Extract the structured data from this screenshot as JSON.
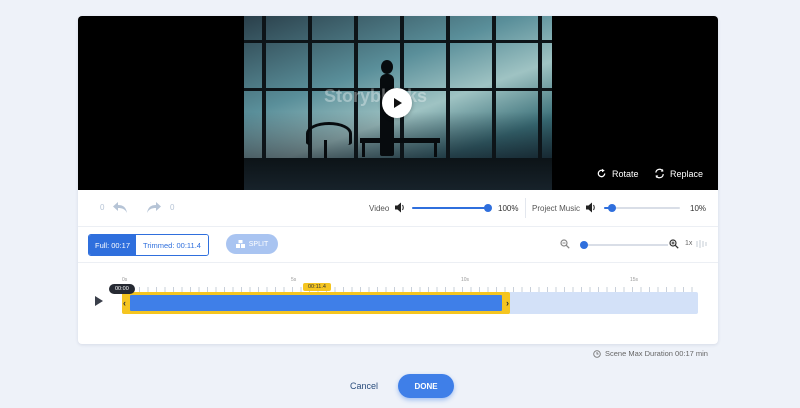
{
  "video": {
    "watermark": "Storyblocks",
    "rotate_label": "Rotate",
    "replace_label": "Replace"
  },
  "controls": {
    "undo_count": "0",
    "redo_count": "0",
    "video_label": "Video",
    "video_volume": "100%",
    "video_volume_level": 1.0,
    "music_label": "Project Music",
    "music_volume": "10%",
    "music_volume_level": 0.1
  },
  "trim": {
    "full_label": "Full: 00:17",
    "trimmed_label": "Trimmed: 00:11.4",
    "split_label": "SPLIT",
    "zoom_level_label": "1x",
    "zoom_level": 0.0
  },
  "timeline": {
    "ticks": [
      "0s",
      "5s",
      "10s",
      "15s"
    ],
    "current_time": "00:00",
    "trim_end": "00:11.4"
  },
  "footer": {
    "max_duration": "Scene Max Duration 00:17 min",
    "cancel_label": "Cancel",
    "done_label": "DONE"
  },
  "colors": {
    "accent": "#3f7fe8",
    "clip_border": "#f5c520"
  }
}
